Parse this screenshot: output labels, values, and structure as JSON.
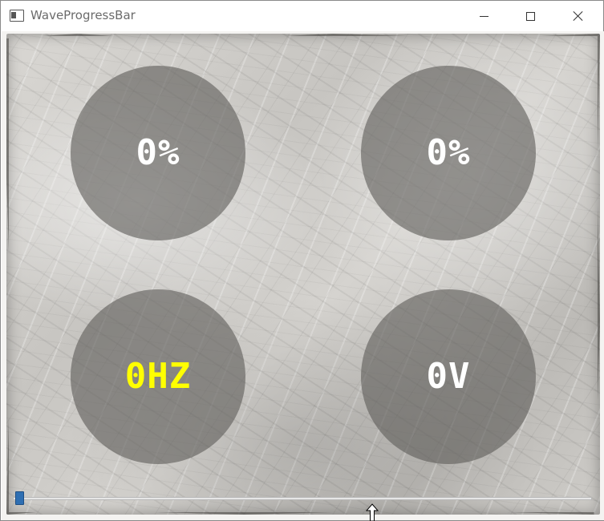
{
  "window": {
    "title": "WaveProgressBar"
  },
  "gauges": [
    {
      "label": "0%",
      "value": 0,
      "text_color": "#ffffff"
    },
    {
      "label": "0%",
      "value": 0,
      "text_color": "#ffffff"
    },
    {
      "label": "0HZ",
      "value": 0,
      "text_color": "#ffff00"
    },
    {
      "label": "0V",
      "value": 0,
      "text_color": "#ffffff"
    }
  ],
  "slider": {
    "value": 0,
    "handle_color": "#2f6fb2"
  },
  "icons": {
    "app": "app-window-icon",
    "minimize": "minimize-icon",
    "maximize": "maximize-icon",
    "close": "close-icon",
    "cursor": "mouse-pointer-icon"
  }
}
